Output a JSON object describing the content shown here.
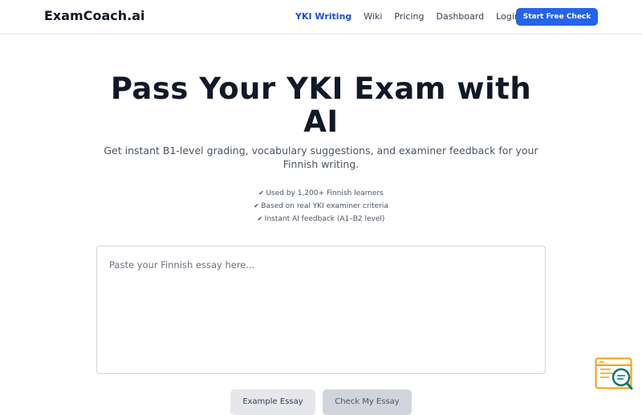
{
  "header": {
    "logo": "ExamCoach.ai",
    "nav": [
      {
        "label": "YKI Writing",
        "active": true
      },
      {
        "label": "Wiki",
        "active": false
      },
      {
        "label": "Pricing",
        "active": false
      },
      {
        "label": "Dashboard",
        "active": false
      },
      {
        "label": "Login",
        "active": false
      }
    ],
    "cta_label": "Start Free Check"
  },
  "hero": {
    "title": "Pass Your YKI Exam with AI",
    "subtitle": "Get instant B1-level grading, vocabulary suggestions, and examiner feedback for your Finnish writing.",
    "checks": [
      "Used by 1,200+ Finnish learners",
      "Based on real YKI examiner criteria",
      "Instant AI feedback (A1–B2 level)"
    ]
  },
  "essay": {
    "placeholder": "Paste your Finnish essay here...",
    "value": ""
  },
  "actions": {
    "example_label": "Example Essay",
    "check_label": "Check My Essay"
  },
  "widget": {
    "icon": "search-document-icon",
    "colors": {
      "accent": "#f59e0b",
      "lens": "#0f766e"
    }
  },
  "colors": {
    "primary": "#2563eb",
    "active_nav": "#1d4ed8",
    "text": "#111827",
    "muted": "#4b5563"
  }
}
